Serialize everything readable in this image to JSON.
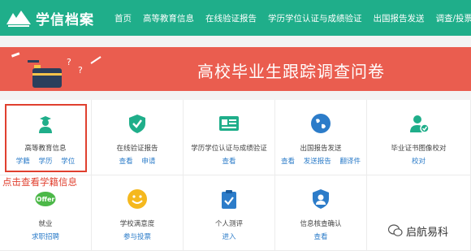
{
  "brand": {
    "name": "学信档案"
  },
  "nav": {
    "items": [
      "首页",
      "高等教育信息",
      "在线验证报告",
      "学历学位认证与成绩验证",
      "出国报告发送",
      "调查/投票"
    ]
  },
  "banner": {
    "title": "高校毕业生跟踪调查问卷"
  },
  "services": [
    {
      "icon": "graduate-icon",
      "label": "高等教育信息",
      "links": [
        "学籍",
        "学历",
        "学位"
      ]
    },
    {
      "icon": "shield-check-icon",
      "label": "在线验证报告",
      "links": [
        "查看",
        "申请"
      ]
    },
    {
      "icon": "id-card-icon",
      "label": "学历学位认证与成绩验证",
      "links": [
        "查看"
      ]
    },
    {
      "icon": "globe-icon",
      "label": "出国报告发送",
      "links": [
        "查看",
        "发送报告",
        "翻译件"
      ]
    },
    {
      "icon": "user-check-icon",
      "label": "毕业证书图像校对",
      "links": [
        "校对"
      ]
    },
    {
      "icon": "offer-icon",
      "label": "就业",
      "links": [
        "求职招聘"
      ]
    },
    {
      "icon": "smile-icon",
      "label": "学校满意度",
      "links": [
        "参与投票"
      ]
    },
    {
      "icon": "clipboard-check-icon",
      "label": "个人测评",
      "links": [
        "进入"
      ]
    },
    {
      "icon": "user-shield-icon",
      "label": "信息核查确认",
      "links": [
        "查看"
      ]
    }
  ],
  "annotation": {
    "text": "点击查看学籍信息"
  },
  "watermark": {
    "text": "启航易科"
  },
  "colors": {
    "nav": "#1fae8a",
    "banner": "#ea5d4f",
    "link": "#2c7cc9",
    "annotation": "#e0402f"
  }
}
